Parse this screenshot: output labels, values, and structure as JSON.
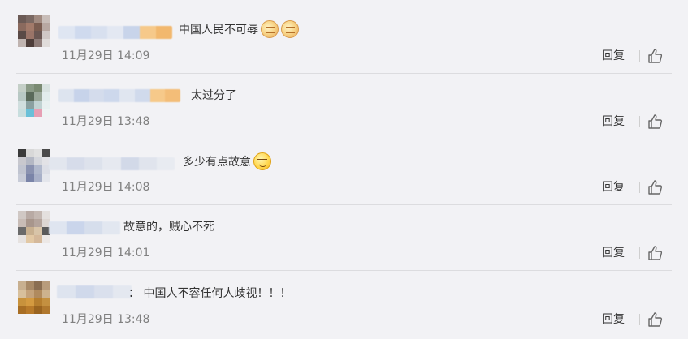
{
  "comments": [
    {
      "text": "中国人民不可辱",
      "emojis": [
        "fist-icon",
        "fist-icon"
      ],
      "time": "11月29日 14:09",
      "reply_label": "回复"
    },
    {
      "text": "太过分了",
      "emojis": [],
      "time": "11月29日 13:48",
      "reply_label": "回复"
    },
    {
      "text": "多少有点故意",
      "emojis": [
        "smirk-icon"
      ],
      "time": "11月29日 14:08",
      "reply_label": "回复"
    },
    {
      "text": "故意的，贼心不死",
      "emojis": [],
      "time": "11月29日 14:01",
      "reply_label": "回复"
    },
    {
      "text": "： 中国人不容任何人歧视！！！",
      "emojis": [],
      "time": "11月29日 13:48",
      "reply_label": "回复"
    }
  ],
  "colors": {
    "background": "#f2f2f5",
    "divider": "#dcdcdf",
    "time_text": "#808080",
    "body_text": "#333333"
  }
}
